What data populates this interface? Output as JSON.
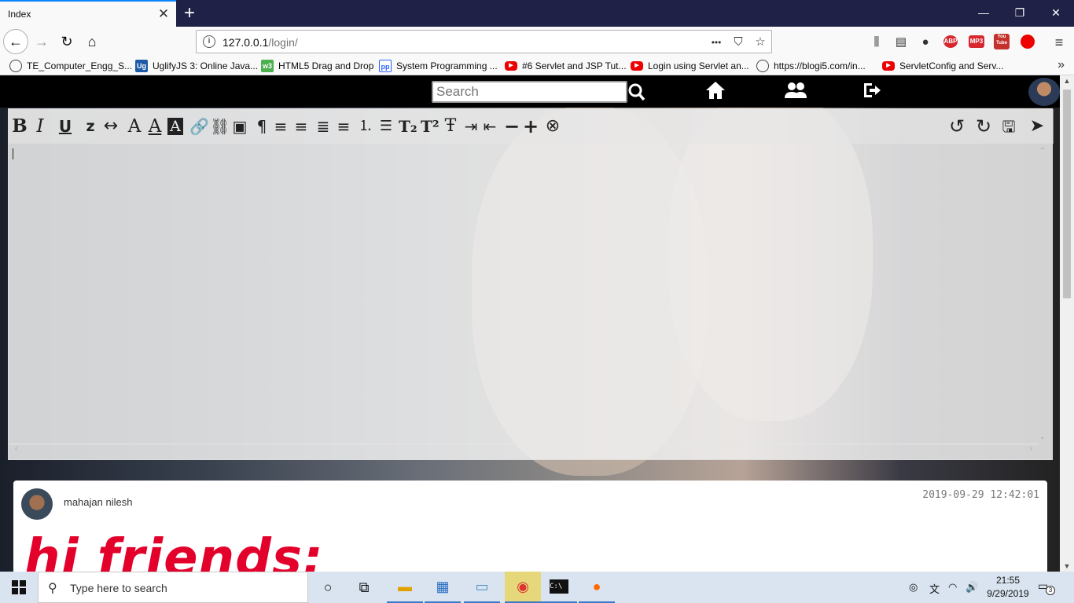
{
  "browser": {
    "tab_title": "Index",
    "close_tab_symbol": "✕",
    "new_tab_symbol": "+",
    "url_host": "127.0.0.1",
    "url_path": "/login/",
    "page_actions_symbol": "•••",
    "bookmarks": [
      {
        "label": "TE_Computer_Engg_S...",
        "icon": "globe-icon"
      },
      {
        "label": "UglifyJS 3: Online Java...",
        "icon": "uglify-icon"
      },
      {
        "label": "HTML5 Drag and Drop",
        "icon": "w3-icon"
      },
      {
        "label": "System Programming ...",
        "icon": "pp-icon"
      },
      {
        "label": "#6 Servlet and JSP Tut...",
        "icon": "youtube-icon"
      },
      {
        "label": "Login using Servlet an...",
        "icon": "youtube-icon"
      },
      {
        "label": "https://blogi5.com/in...",
        "icon": "globe-icon"
      },
      {
        "label": "ServletConfig and Serv...",
        "icon": "youtube-icon"
      }
    ],
    "extensions": [
      "ABP",
      "MP3",
      "You Tube"
    ]
  },
  "page": {
    "search_placeholder": "Search",
    "editor_toolbar": [
      "bold",
      "italic",
      "underline",
      "strikethrough",
      "expand",
      "font",
      "font-color",
      "font-bg",
      "link",
      "unlink",
      "image",
      "paragraph",
      "align-right",
      "align-left",
      "justify",
      "align-center",
      "ordered-list",
      "unordered-list",
      "subscript",
      "superscript",
      "text-height",
      "indent",
      "outdent",
      "minus",
      "plus",
      "remove",
      "undo",
      "redo",
      "save-cancel",
      "send"
    ],
    "post": {
      "author": "mahajan nilesh",
      "date": "2019-09-29 12:42:01",
      "text": "hi friends;"
    }
  },
  "taskbar": {
    "search_placeholder": "Type here to search",
    "time": "21:55",
    "date": "9/29/2019",
    "notifications": "3"
  }
}
